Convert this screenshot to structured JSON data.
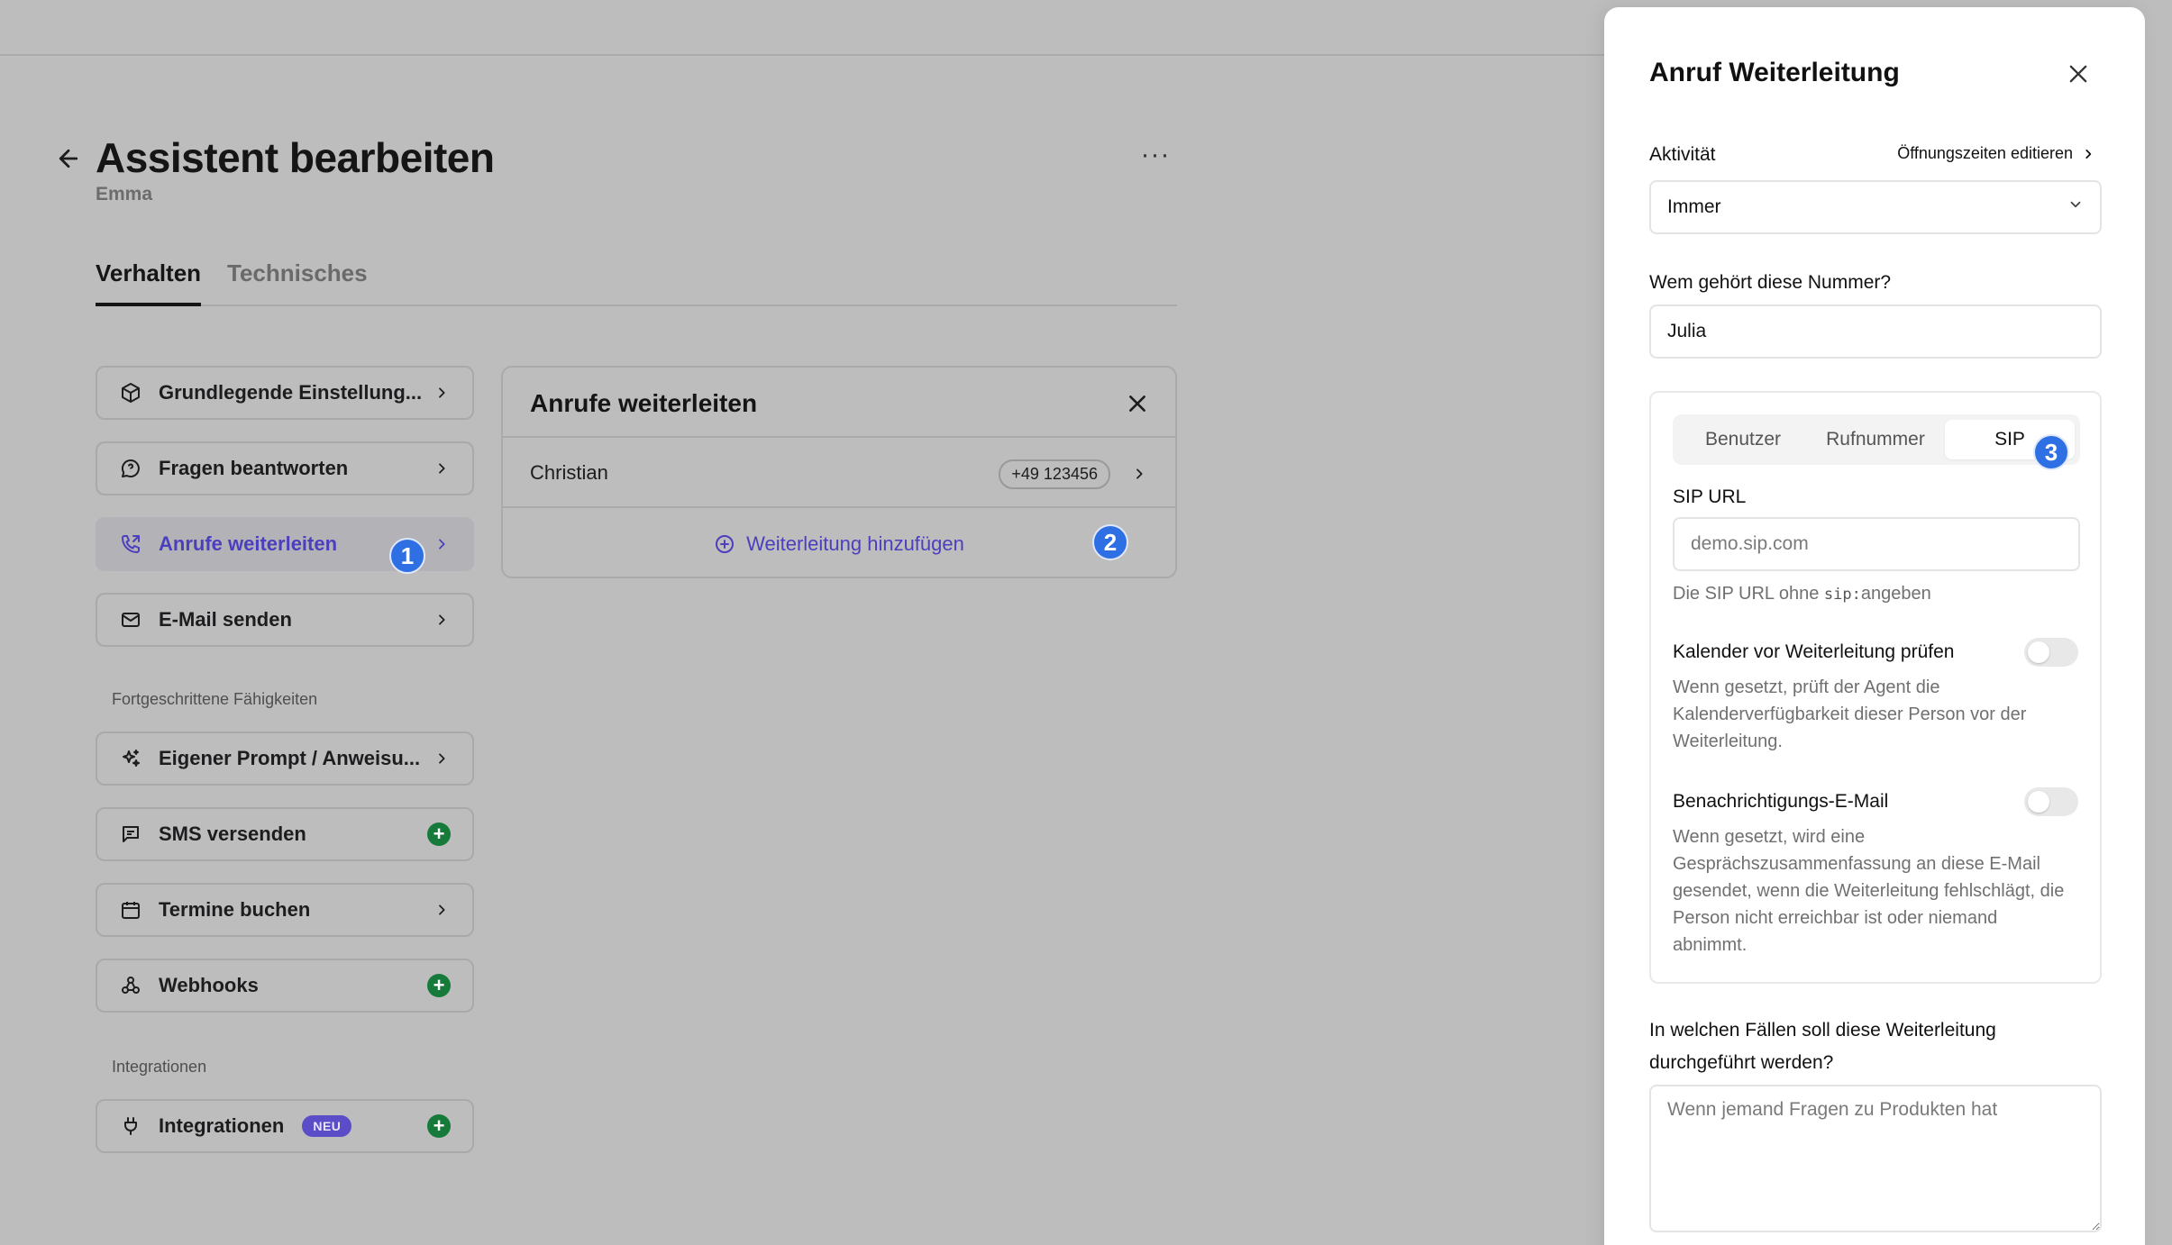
{
  "page": {
    "title": "Assistent bearbeiten",
    "subtitle": "Emma",
    "more_label": "···",
    "tabs": [
      {
        "label": "Verhalten",
        "active": true
      },
      {
        "label": "Technisches",
        "active": false
      }
    ]
  },
  "nav": {
    "items": [
      {
        "label": "Grundlegende Einstellung...",
        "icon": "cube-icon",
        "action": "chevron"
      },
      {
        "label": "Fragen beantworten",
        "icon": "chat-bubble-icon",
        "action": "chevron"
      },
      {
        "label": "Anrufe weiterleiten",
        "icon": "phone-forward-icon",
        "action": "chevron",
        "active": true
      },
      {
        "label": "E-Mail senden",
        "icon": "mail-icon",
        "action": "chevron"
      }
    ],
    "advanced_label": "Fortgeschrittene Fähigkeiten",
    "advanced_items": [
      {
        "label": "Eigener Prompt / Anweisu...",
        "icon": "sparkle-icon",
        "action": "chevron"
      },
      {
        "label": "SMS versenden",
        "icon": "message-icon",
        "action": "plus"
      },
      {
        "label": "Termine buchen",
        "icon": "calendar-icon",
        "action": "chevron"
      },
      {
        "label": "Webhooks",
        "icon": "webhook-icon",
        "action": "plus"
      }
    ],
    "integrations_label": "Integrationen",
    "integration_item": {
      "label": "Integrationen",
      "badge": "NEU",
      "icon": "plug-icon",
      "action": "plus"
    }
  },
  "steps": [
    "1",
    "2",
    "3"
  ],
  "forward_card": {
    "title": "Anrufe weiterleiten",
    "rows": [
      {
        "name": "Christian",
        "phone": "+49 123456"
      }
    ],
    "add_label": "Weiterleitung hinzufügen"
  },
  "drawer": {
    "title": "Anruf Weiterleitung",
    "activity_label": "Aktivität",
    "hours_link": "Öffnungszeiten editieren",
    "activity_value": "Immer",
    "owner_label": "Wem gehört diese Nummer?",
    "owner_value": "Julia",
    "segments": [
      "Benutzer",
      "Rufnummer",
      "SIP"
    ],
    "selected_segment": "SIP",
    "sip_label": "SIP URL",
    "sip_placeholder": "demo.sip.com",
    "sip_help_prefix": "Die SIP URL ohne ",
    "sip_help_code": "sip:",
    "sip_help_suffix": "angeben",
    "calendar_label": "Kalender vor Weiterleitung prüfen",
    "calendar_help": "Wenn gesetzt, prüft der Agent die Kalenderverfügbarkeit dieser Person vor der Weiterleitung.",
    "calendar_on": false,
    "email_label": "Benachrichtigungs-E-Mail",
    "email_help": "Wenn gesetzt, wird eine Gesprächszusammenfassung an diese E-Mail gesendet, wenn die Weiterleitung fehlschlägt, die Person nicht erreichbar ist oder niemand abnimmt.",
    "email_on": false,
    "cases_label": "In welchen Fällen soll diese Weiterleitung durchgeführt werden?",
    "cases_placeholder": "Wenn jemand Fragen zu Produkten hat"
  },
  "colors": {
    "overlay_bg": "#bdbdbd",
    "accent": "#4c3fbd",
    "step_badge": "#2f6fe4",
    "plus_green": "#157a3a",
    "neu_badge": "#5b4cc7"
  }
}
